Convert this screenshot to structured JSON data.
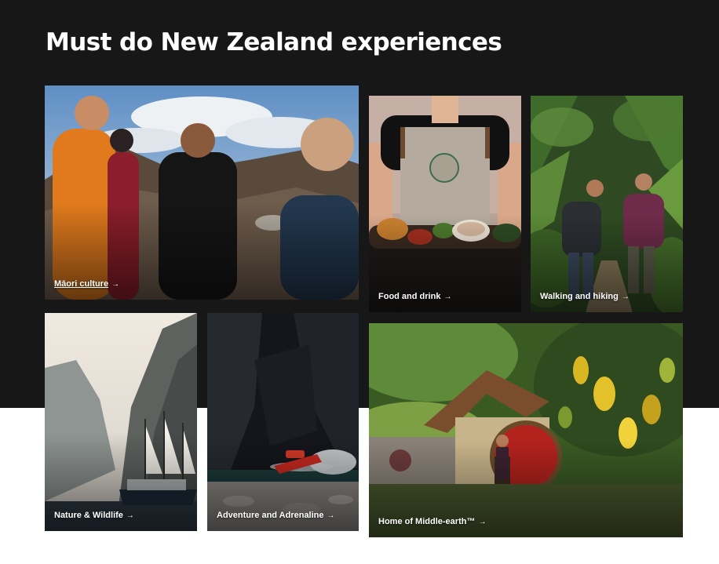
{
  "page": {
    "title": "Must do New Zealand experiences"
  },
  "cards": [
    {
      "label": "Māori culture",
      "arrow": "→"
    },
    {
      "label": "Food and drink",
      "arrow": "→"
    },
    {
      "label": "Walking and hiking",
      "arrow": "→"
    },
    {
      "label": "Nature & Wildlife",
      "arrow": "→"
    },
    {
      "label": "Adventure and Adrenaline",
      "arrow": "→"
    },
    {
      "label": "Home of Middle-earth™",
      "arrow": "→"
    }
  ],
  "colors": {
    "background_dark": "#171717",
    "background_light": "#ffffff",
    "text": "#ffffff"
  }
}
